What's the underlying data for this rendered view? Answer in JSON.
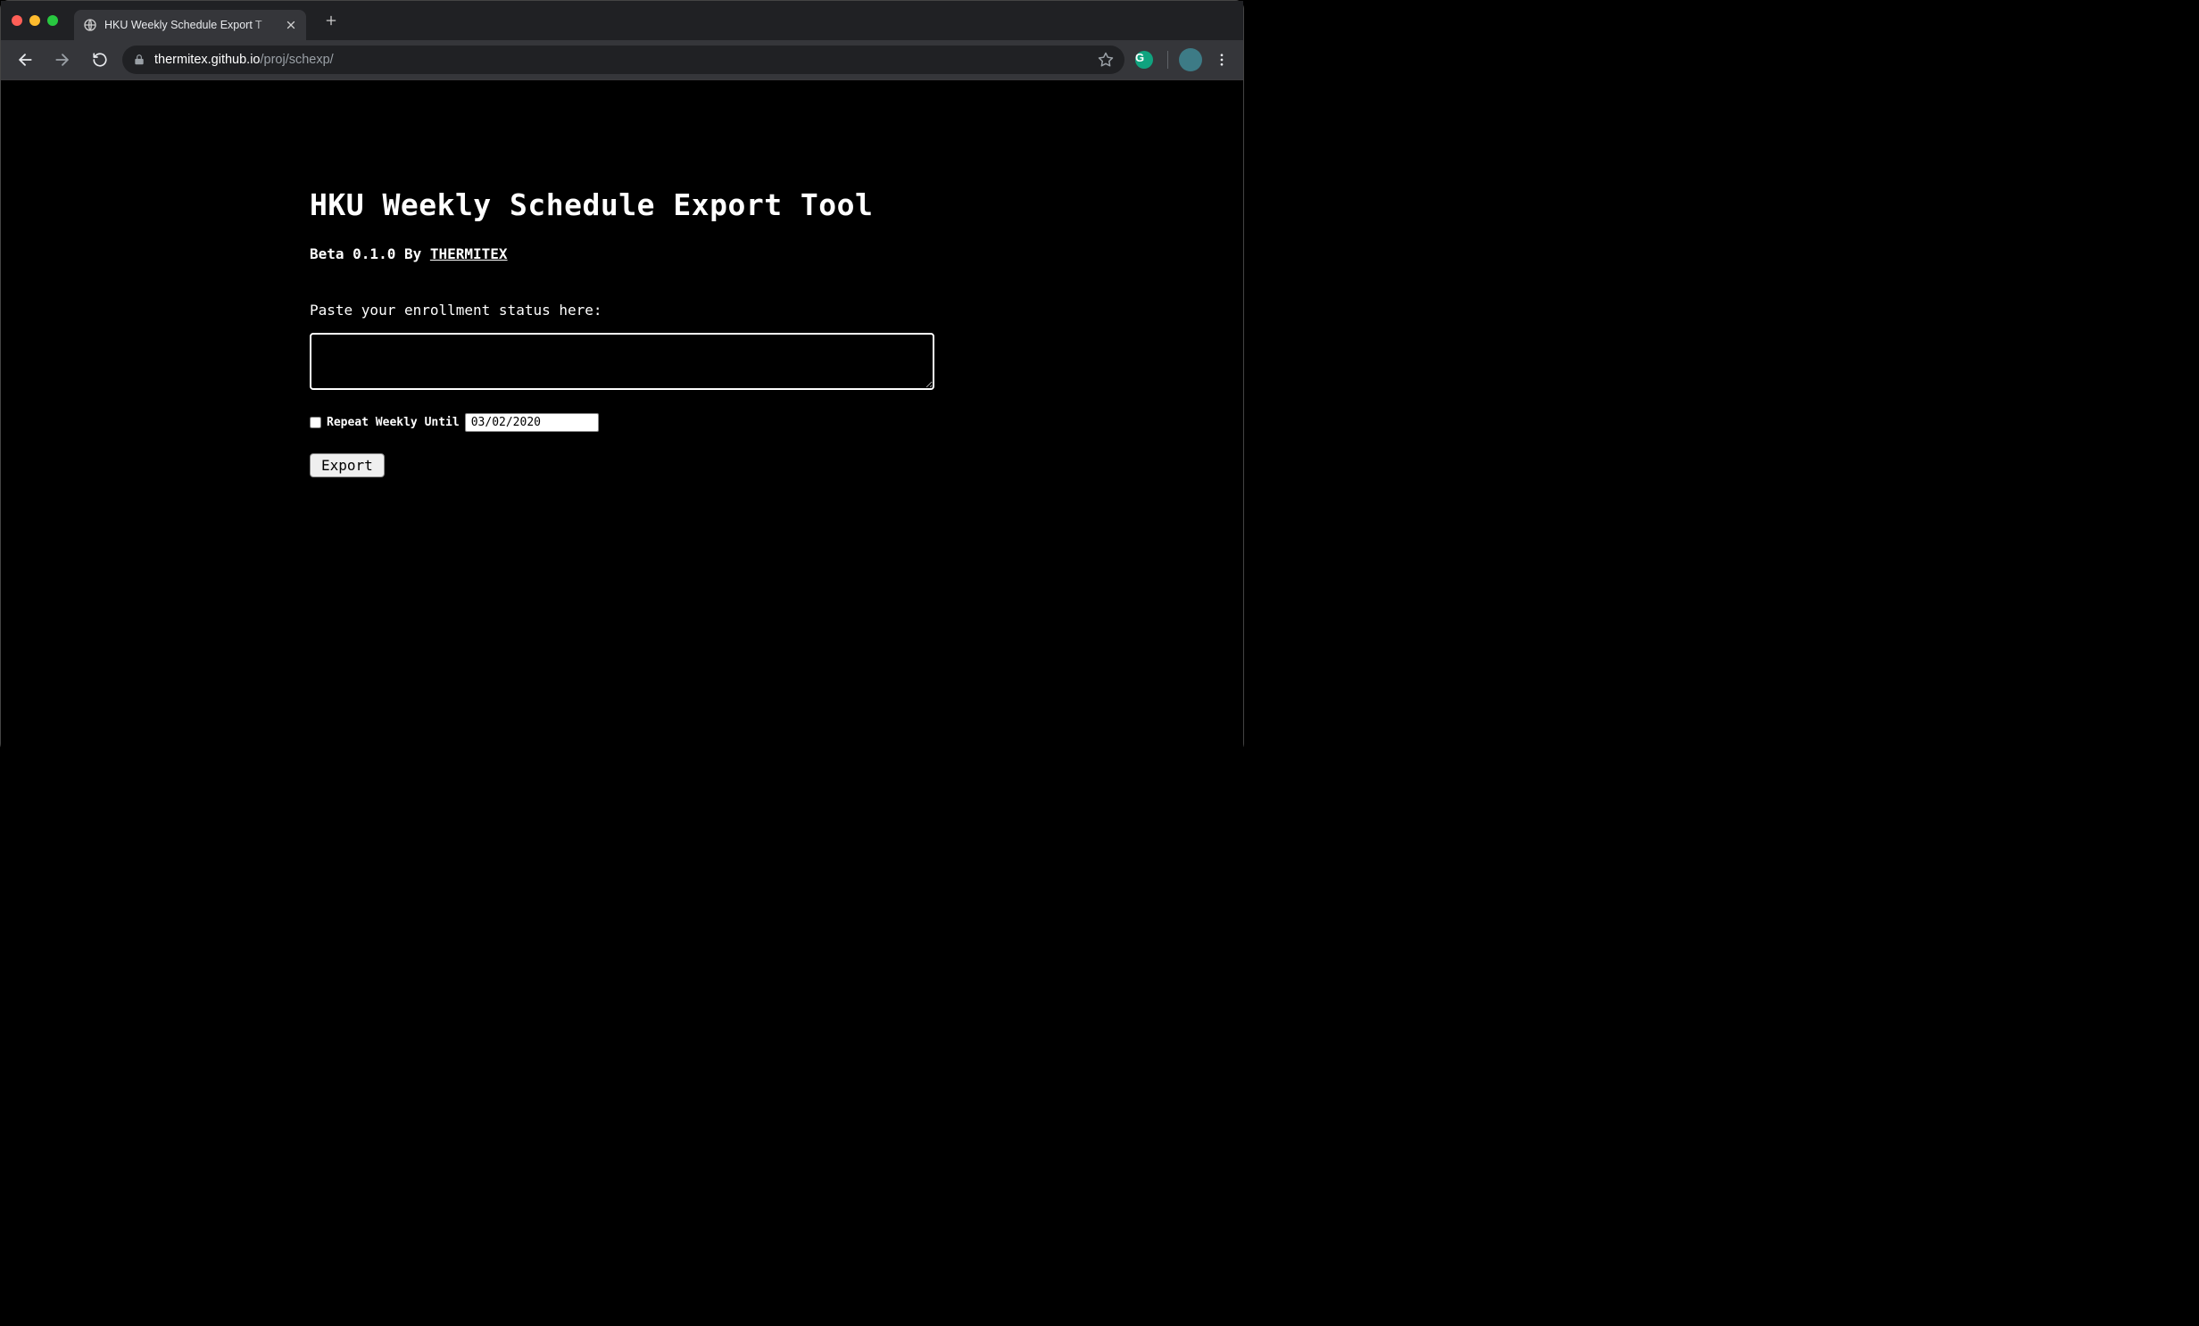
{
  "browser": {
    "tab_title": "HKU Weekly Schedule Export T",
    "url_host": "thermitex.github.io",
    "url_path": "/proj/schexp/"
  },
  "page": {
    "heading": "HKU Weekly Schedule Export Tool",
    "byline_prefix": "Beta 0.1.0 By ",
    "byline_link_text": "THERMITEX",
    "paste_label": "Paste your enrollment status here:",
    "textarea_value": "",
    "repeat_label": "Repeat Weekly Until",
    "repeat_checked": false,
    "repeat_date": "03/02/2020",
    "export_label": "Export"
  }
}
